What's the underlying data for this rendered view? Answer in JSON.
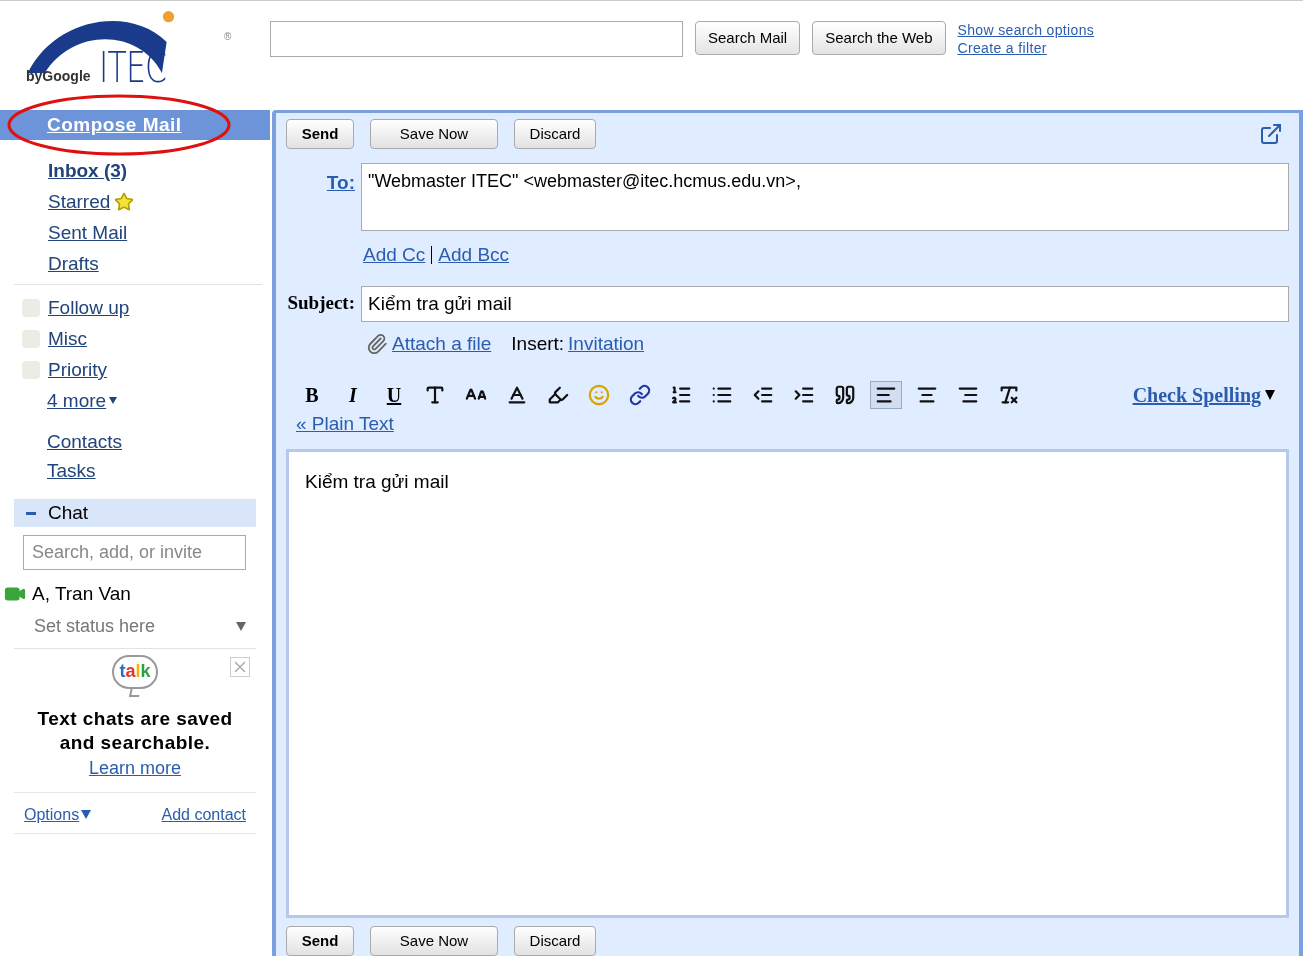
{
  "logo": {
    "brand": "ITEC",
    "tagline": "byGoogle",
    "mark": "®"
  },
  "search": {
    "buttons": [
      "Search Mail",
      "Search the Web"
    ],
    "links": [
      "Show search options",
      "Create a filter"
    ]
  },
  "sidebar": {
    "compose": "Compose Mail",
    "folders": [
      {
        "label": "Inbox (3)",
        "unread": true,
        "star": false
      },
      {
        "label": "Starred",
        "unread": false,
        "star": true
      },
      {
        "label": "Sent Mail",
        "unread": false,
        "star": false
      },
      {
        "label": "Drafts",
        "unread": false,
        "star": false
      }
    ],
    "labels": [
      {
        "label": "Follow up",
        "color": "#ecece4"
      },
      {
        "label": "Misc",
        "color": "#ecece4"
      },
      {
        "label": "Priority",
        "color": "#ecece4"
      }
    ],
    "more": "4 more",
    "links": [
      "Contacts",
      "Tasks"
    ]
  },
  "chat": {
    "title": "Chat",
    "expanded": true,
    "search_placeholder": "Search, add, or invite",
    "user": "A, Tran Van",
    "status": "Set status here",
    "logo_text": "talk",
    "promo": "Text chats are saved and searchable.",
    "promo_link": "Learn more",
    "options": "Options",
    "add_contact": "Add contact"
  },
  "compose": {
    "buttons": [
      "Send",
      "Save Now",
      "Discard"
    ],
    "to_label": "To:",
    "to": "\"Webmaster ITEC\" <webmaster@itec.hcmus.edu.vn>,",
    "add_cc": "Add Cc",
    "add_bcc": "Add Bcc",
    "subject_label": "Subject:",
    "subject": "Kiểm tra gửi mail",
    "attach": "Attach a file",
    "insert_label": "Insert:",
    "insert_link": "Invitation",
    "toolbar": [
      {
        "kind": "bold",
        "glyph": "B",
        "selected": false
      },
      {
        "kind": "italic",
        "glyph": "I",
        "selected": false
      },
      {
        "kind": "underline",
        "glyph": "U",
        "selected": false
      },
      {
        "kind": "font",
        "selected": false
      },
      {
        "kind": "size",
        "selected": false
      },
      {
        "kind": "text-color",
        "selected": false
      },
      {
        "kind": "highlight",
        "selected": false
      },
      {
        "kind": "emoticon",
        "selected": false
      },
      {
        "kind": "link",
        "selected": false
      },
      {
        "kind": "numbered-list",
        "selected": false
      },
      {
        "kind": "bulleted-list",
        "selected": false
      },
      {
        "kind": "outdent",
        "selected": false
      },
      {
        "kind": "indent",
        "selected": false
      },
      {
        "kind": "quote",
        "selected": false
      },
      {
        "kind": "align-left",
        "selected": true
      },
      {
        "kind": "align-center",
        "selected": false
      },
      {
        "kind": "align-right",
        "selected": false
      },
      {
        "kind": "remove-formatting",
        "selected": false
      }
    ],
    "plain_text": "« Plain Text",
    "check_spelling": "Check Spelling",
    "body": "Kiểm tra gửi mail",
    "bottom_buttons": [
      "Send",
      "Save Now",
      "Discard"
    ]
  }
}
